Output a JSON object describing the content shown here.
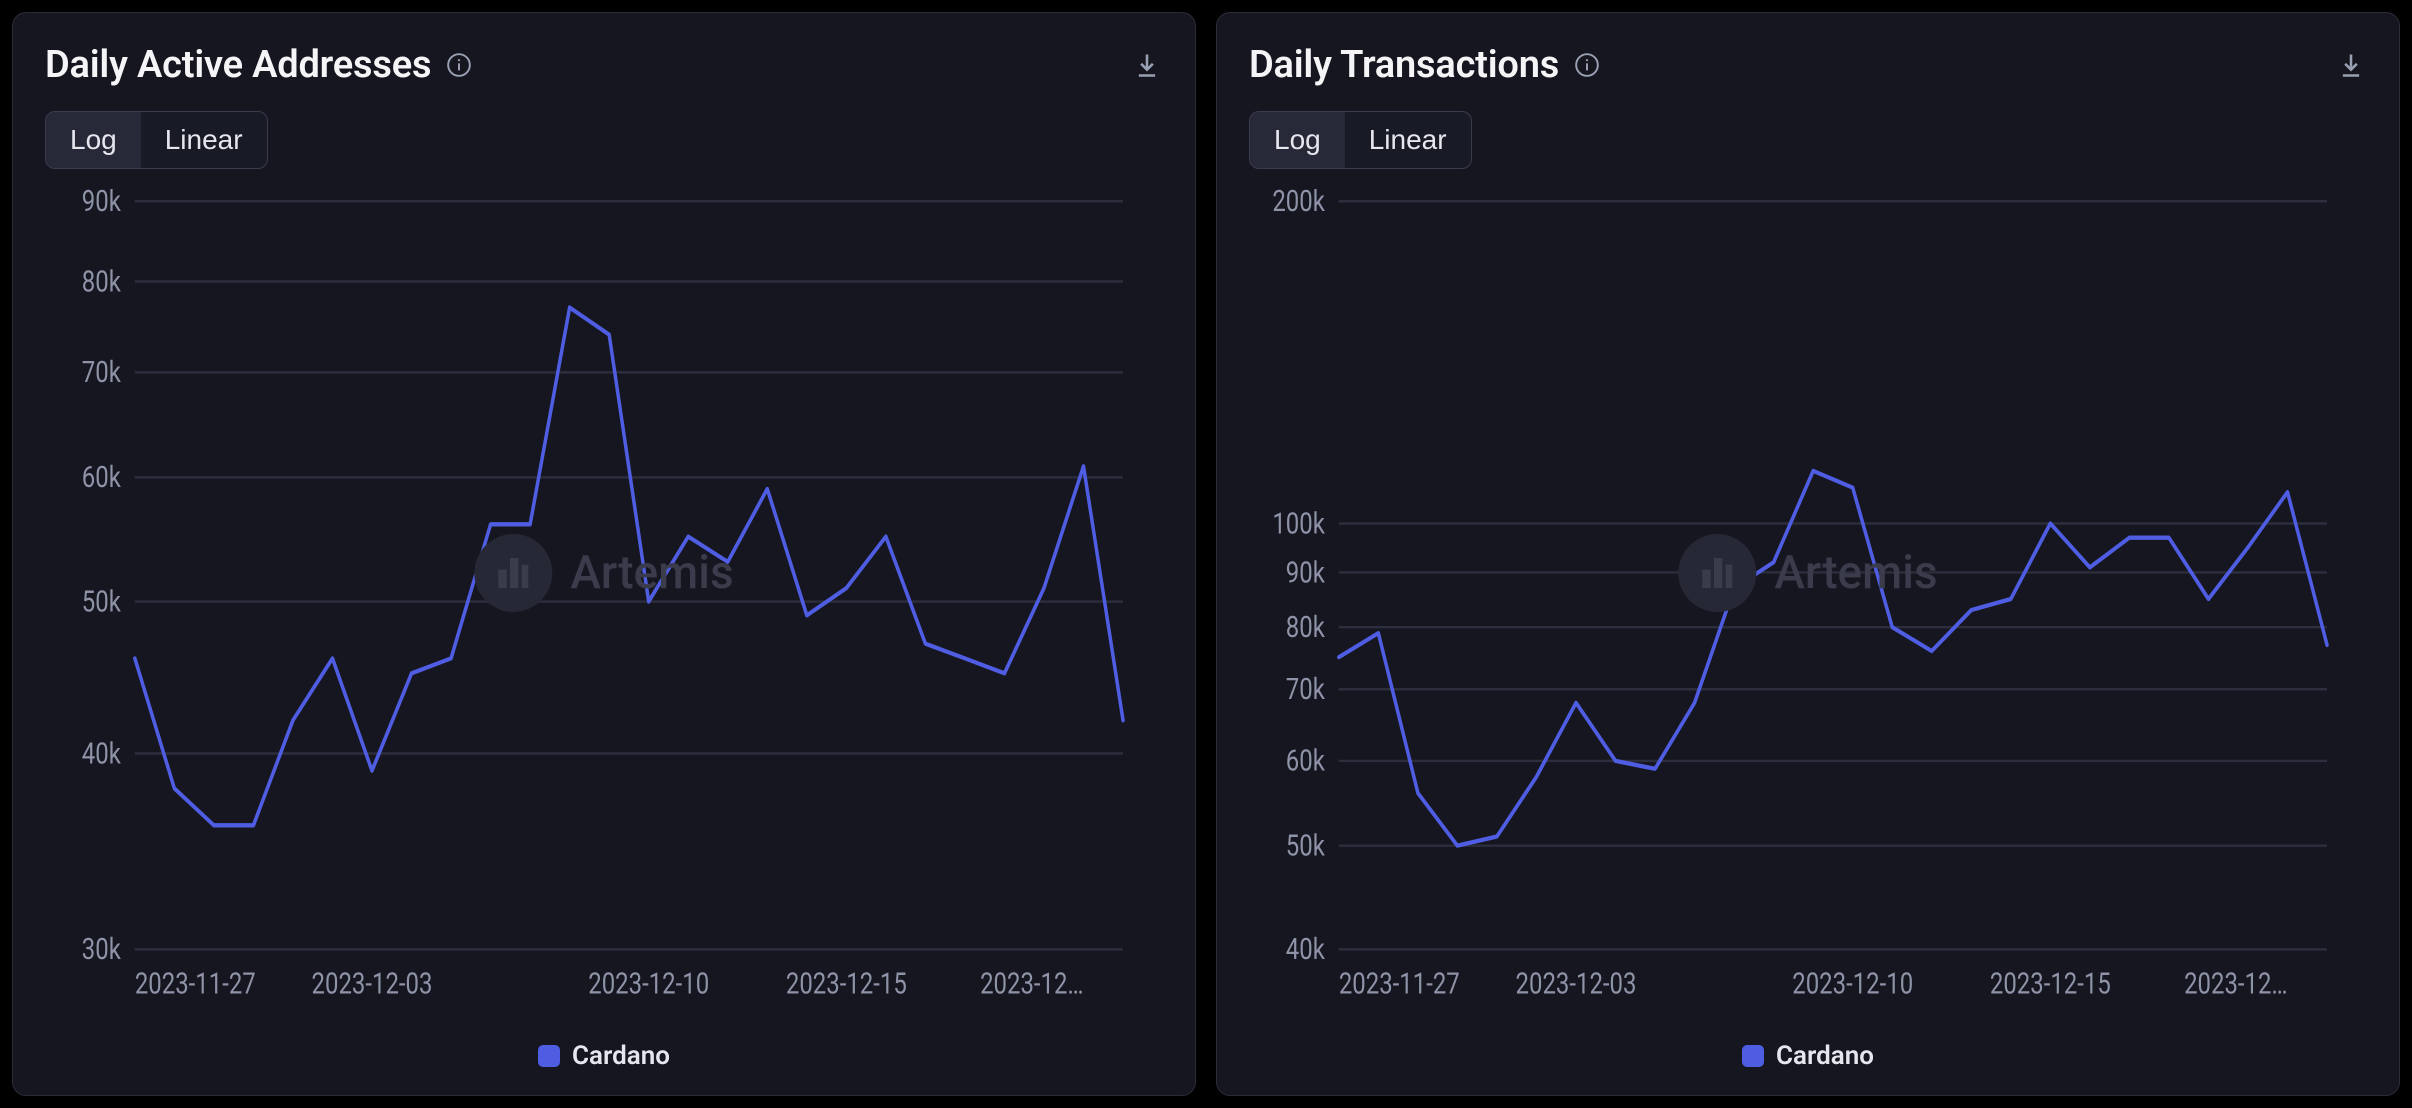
{
  "watermark": "Artemis",
  "panels": [
    {
      "title": "Daily Active Addresses",
      "scale_active": "Log",
      "scale_other": "Linear",
      "legend": "Cardano"
    },
    {
      "title": "Daily Transactions",
      "scale_active": "Log",
      "scale_other": "Linear",
      "legend": "Cardano"
    }
  ],
  "chart_data": [
    {
      "type": "line",
      "title": "Daily Active Addresses",
      "xlabel": "",
      "ylabel": "",
      "y_scale": "log",
      "ylim": [
        30000,
        90000
      ],
      "y_ticks": [
        30000,
        40000,
        50000,
        60000,
        70000,
        80000,
        90000
      ],
      "y_tick_labels": [
        "30k",
        "40k",
        "50k",
        "60k",
        "70k",
        "80k",
        "90k"
      ],
      "x": [
        "2023-11-27",
        "2023-11-28",
        "2023-11-29",
        "2023-11-30",
        "2023-12-01",
        "2023-12-02",
        "2023-12-03",
        "2023-12-04",
        "2023-12-05",
        "2023-12-06",
        "2023-12-07",
        "2023-12-08",
        "2023-12-09",
        "2023-12-10",
        "2023-12-11",
        "2023-12-12",
        "2023-12-13",
        "2023-12-14",
        "2023-12-15",
        "2023-12-16",
        "2023-12-17",
        "2023-12-18",
        "2023-12-19",
        "2023-12-20",
        "2023-12-21",
        "2023-12-22"
      ],
      "x_tick_labels": [
        "2023-11-27",
        "2023-12-03",
        "2023-12-10",
        "2023-12-15",
        "2023-12…"
      ],
      "x_tick_dates": [
        "2023-11-27",
        "2023-12-03",
        "2023-12-10",
        "2023-12-15",
        "2023-12-21"
      ],
      "series": [
        {
          "name": "Cardano",
          "color": "#4f5de3",
          "values": [
            46000,
            38000,
            36000,
            36000,
            42000,
            46000,
            39000,
            45000,
            46000,
            56000,
            56000,
            77000,
            74000,
            50000,
            55000,
            53000,
            59000,
            49000,
            51000,
            55000,
            47000,
            46000,
            45000,
            51000,
            61000,
            42000
          ]
        }
      ]
    },
    {
      "type": "line",
      "title": "Daily Transactions",
      "xlabel": "",
      "ylabel": "",
      "y_scale": "log",
      "ylim": [
        40000,
        200000
      ],
      "y_ticks": [
        40000,
        50000,
        60000,
        70000,
        80000,
        90000,
        100000,
        200000
      ],
      "y_tick_labels": [
        "40k",
        "50k",
        "60k",
        "70k",
        "80k",
        "90k",
        "100k",
        "200k"
      ],
      "x": [
        "2023-11-27",
        "2023-11-28",
        "2023-11-29",
        "2023-11-30",
        "2023-12-01",
        "2023-12-02",
        "2023-12-03",
        "2023-12-04",
        "2023-12-05",
        "2023-12-06",
        "2023-12-07",
        "2023-12-08",
        "2023-12-09",
        "2023-12-10",
        "2023-12-11",
        "2023-12-12",
        "2023-12-13",
        "2023-12-14",
        "2023-12-15",
        "2023-12-16",
        "2023-12-17",
        "2023-12-18",
        "2023-12-19",
        "2023-12-20",
        "2023-12-21",
        "2023-12-22"
      ],
      "x_tick_labels": [
        "2023-11-27",
        "2023-12-03",
        "2023-12-10",
        "2023-12-15",
        "2023-12…"
      ],
      "x_tick_dates": [
        "2023-11-27",
        "2023-12-03",
        "2023-12-10",
        "2023-12-15",
        "2023-12-21"
      ],
      "series": [
        {
          "name": "Cardano",
          "color": "#4f5de3",
          "values": [
            75000,
            79000,
            56000,
            50000,
            51000,
            58000,
            68000,
            60000,
            59000,
            68000,
            87000,
            92000,
            112000,
            108000,
            80000,
            76000,
            83000,
            85000,
            100000,
            91000,
            97000,
            97000,
            85000,
            95000,
            107000,
            77000
          ]
        }
      ]
    }
  ]
}
